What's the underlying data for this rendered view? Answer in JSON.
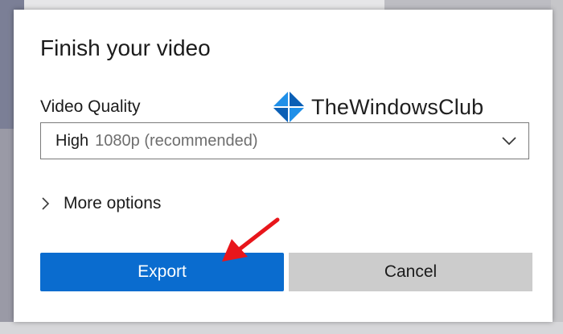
{
  "dialog": {
    "title": "Finish your video",
    "quality_label": "Video Quality",
    "quality_select": {
      "value_main": "High",
      "value_detail": "1080p (recommended)"
    },
    "more_options_label": "More options",
    "export_label": "Export",
    "cancel_label": "Cancel"
  },
  "watermark": {
    "text": "TheWindowsClub"
  },
  "colors": {
    "accent": "#0a6ccf",
    "cancel_bg": "#cccccc",
    "annotation_arrow": "#e8161b",
    "watermark_blue": "#1f8fe8"
  },
  "icons": [
    "windows-logo-icon",
    "chevron-down-icon",
    "chevron-right-icon",
    "red-arrow-annotation"
  ]
}
